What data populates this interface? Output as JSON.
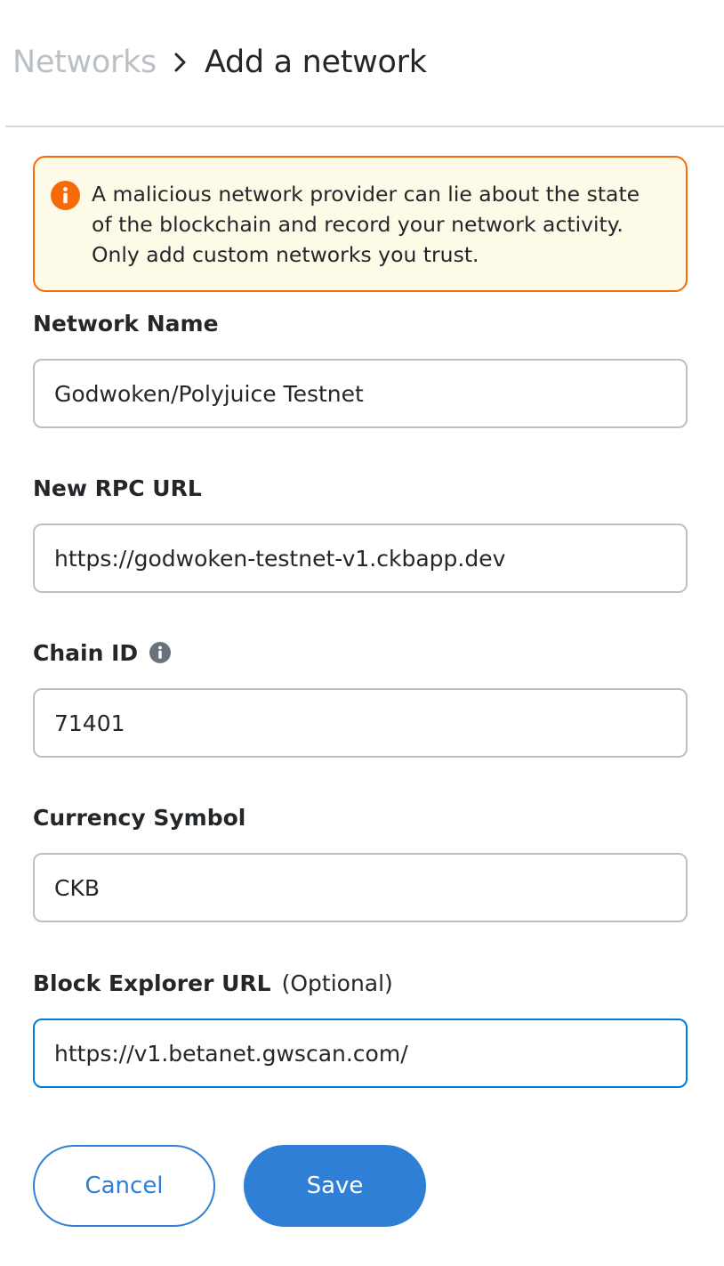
{
  "header": {
    "parent": "Networks",
    "current": "Add a network"
  },
  "warning": {
    "text": "A malicious network provider can lie about the state of the blockchain and record your network activity. Only add custom networks you trust.",
    "icon": "info-icon",
    "color": "#f66a0a",
    "background": "#fefae8"
  },
  "fields": {
    "network_name": {
      "label": "Network Name",
      "value": "Godwoken/Polyjuice Testnet"
    },
    "rpc_url": {
      "label": "New RPC URL",
      "value": "https://godwoken-testnet-v1.ckbapp.dev"
    },
    "chain_id": {
      "label": "Chain ID",
      "value": "71401",
      "icon": "info-icon"
    },
    "currency_symbol": {
      "label": "Currency Symbol",
      "value": "CKB"
    },
    "block_explorer": {
      "label": "Block Explorer URL",
      "optional": "(Optional)",
      "value": "https://v1.betanet.gwscan.com/"
    }
  },
  "buttons": {
    "cancel": "Cancel",
    "save": "Save"
  },
  "colors": {
    "accent": "#2f7fd6",
    "focus_border": "#037dd6",
    "muted": "#bbc0c5"
  }
}
